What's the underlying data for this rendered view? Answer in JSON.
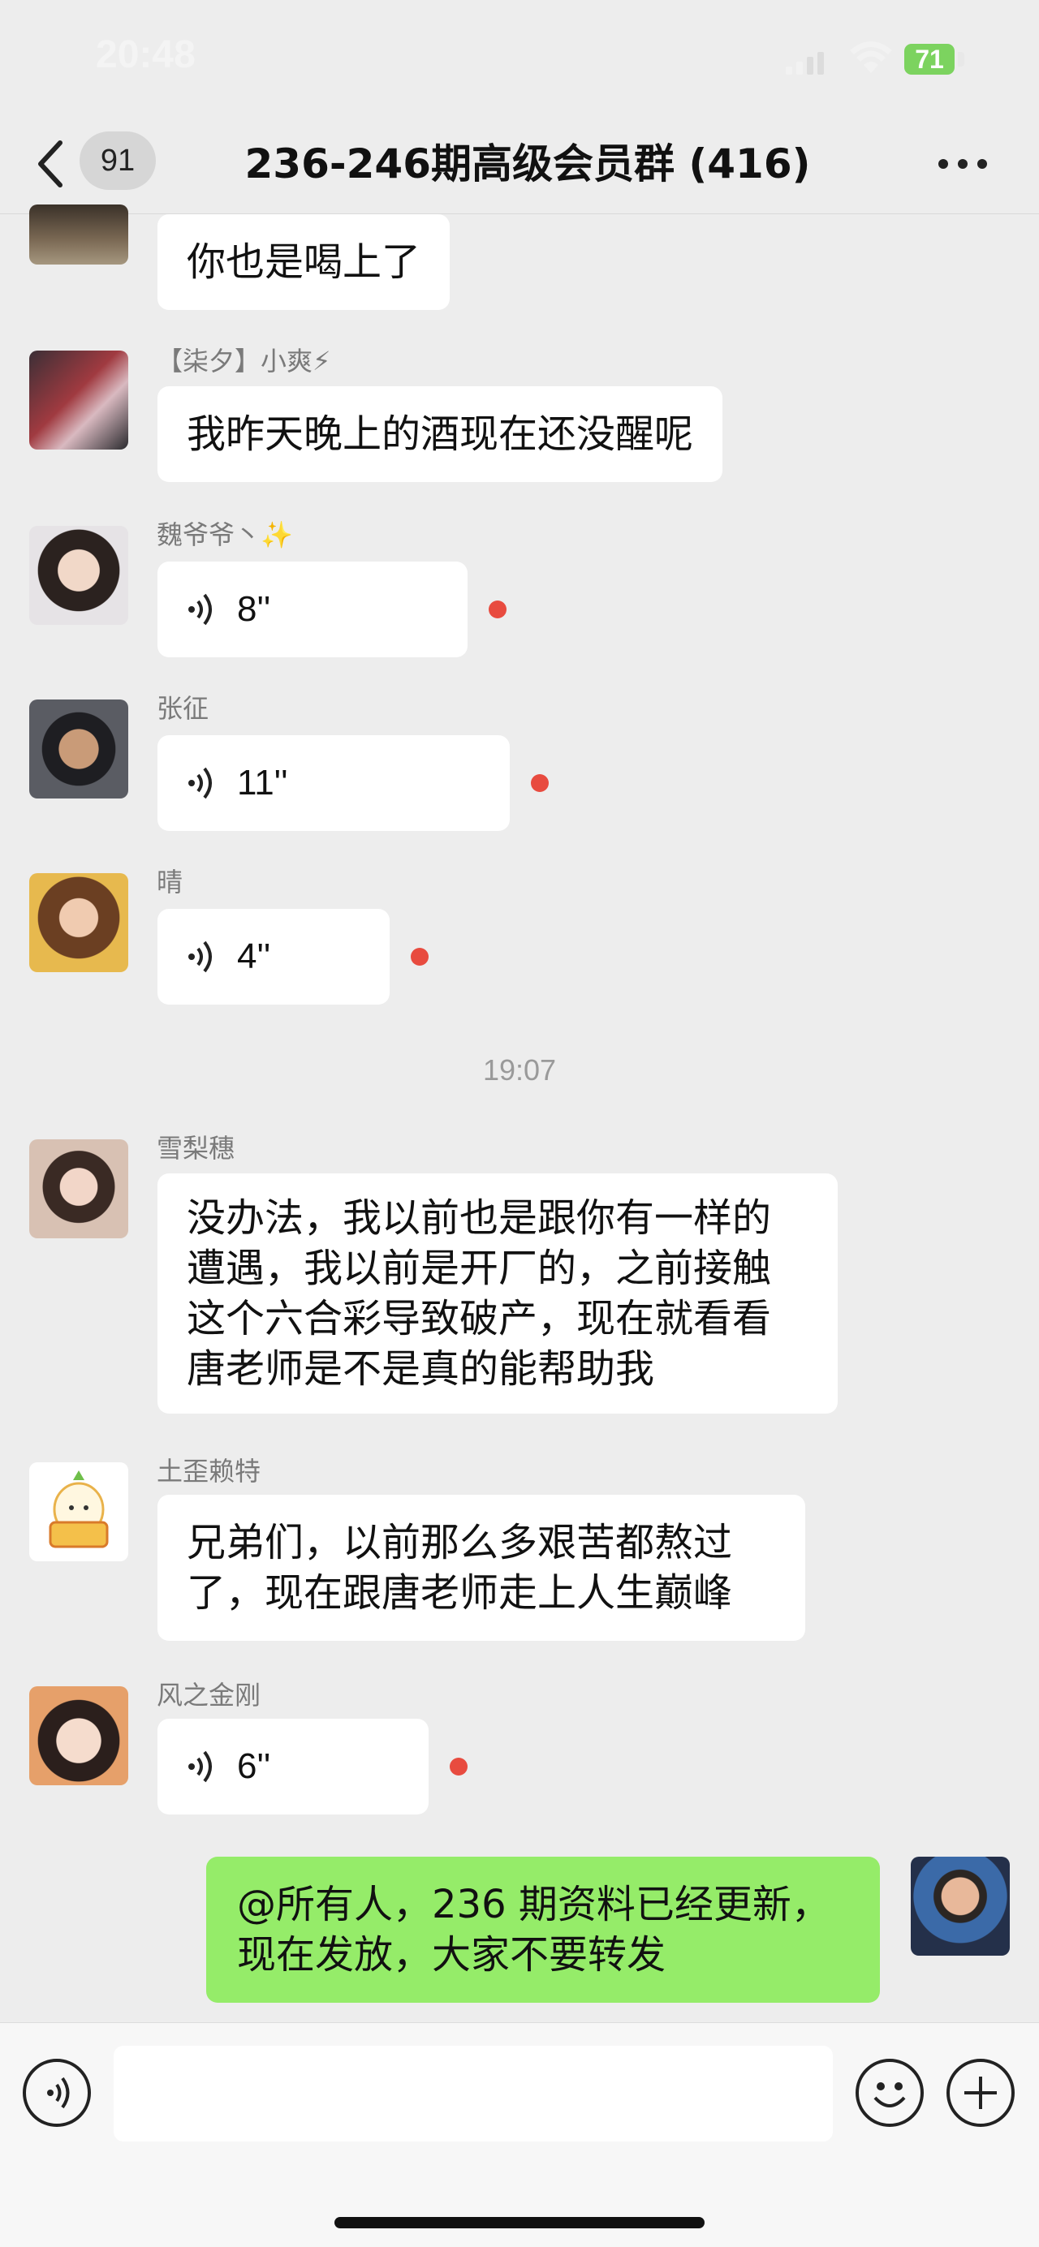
{
  "status_bar": {
    "time": "20:48",
    "battery": "71"
  },
  "nav": {
    "unread_count": "91",
    "title": "236-246期高级会员群 (416)"
  },
  "messages": [
    {
      "type": "text",
      "sender": "",
      "text": "你也是喝上了",
      "avatar_icon": "avatar-icon"
    },
    {
      "type": "text",
      "sender": "【柒夕】小爽⚡",
      "text": "我昨天晚上的酒现在还没醒呢",
      "avatar_icon": "avatar-icon"
    },
    {
      "type": "voice",
      "sender": "魏爷爷丶✨",
      "duration": "8''",
      "avatar_icon": "avatar-icon"
    },
    {
      "type": "voice",
      "sender": "张征",
      "duration": "11''",
      "avatar_icon": "avatar-icon"
    },
    {
      "type": "voice",
      "sender": "晴",
      "duration": "4''",
      "avatar_icon": "avatar-icon"
    },
    {
      "type": "time",
      "text": "19:07"
    },
    {
      "type": "text",
      "sender": "雪梨穗",
      "lines": [
        "没办法，我以前也是跟你有一样的",
        "遭遇，我以前是开厂的，之前接触",
        "这个六合彩导致破产，现在就看看",
        "唐老师是不是真的能帮助我"
      ],
      "avatar_icon": "avatar-icon"
    },
    {
      "type": "text",
      "sender": "土歪赖特",
      "lines": [
        "兄弟们，以前那么多艰苦都熬过",
        "了，现在跟唐老师走上人生巅峰"
      ],
      "avatar_icon": "avatar-icon"
    },
    {
      "type": "voice",
      "sender": "风之金刚",
      "duration": "6''",
      "avatar_icon": "avatar-icon"
    },
    {
      "type": "text",
      "sender": "self",
      "lines": [
        "@所有人，236 期资料已经更新，",
        "现在发放，大家不要转发"
      ],
      "avatar_icon": "avatar-icon"
    }
  ],
  "icons": {
    "back": "chevron-left-icon",
    "more": "more-icon",
    "voice_message": "voice-wave-icon",
    "voice_toggle": "voice-toggle-icon",
    "emoji": "emoji-icon",
    "plus": "plus-icon"
  },
  "colors": {
    "background": "#ededed",
    "self_bubble": "#95ec69",
    "other_bubble": "#ffffff",
    "unread_dot": "#e84b3f",
    "battery": "#7cd35f"
  }
}
